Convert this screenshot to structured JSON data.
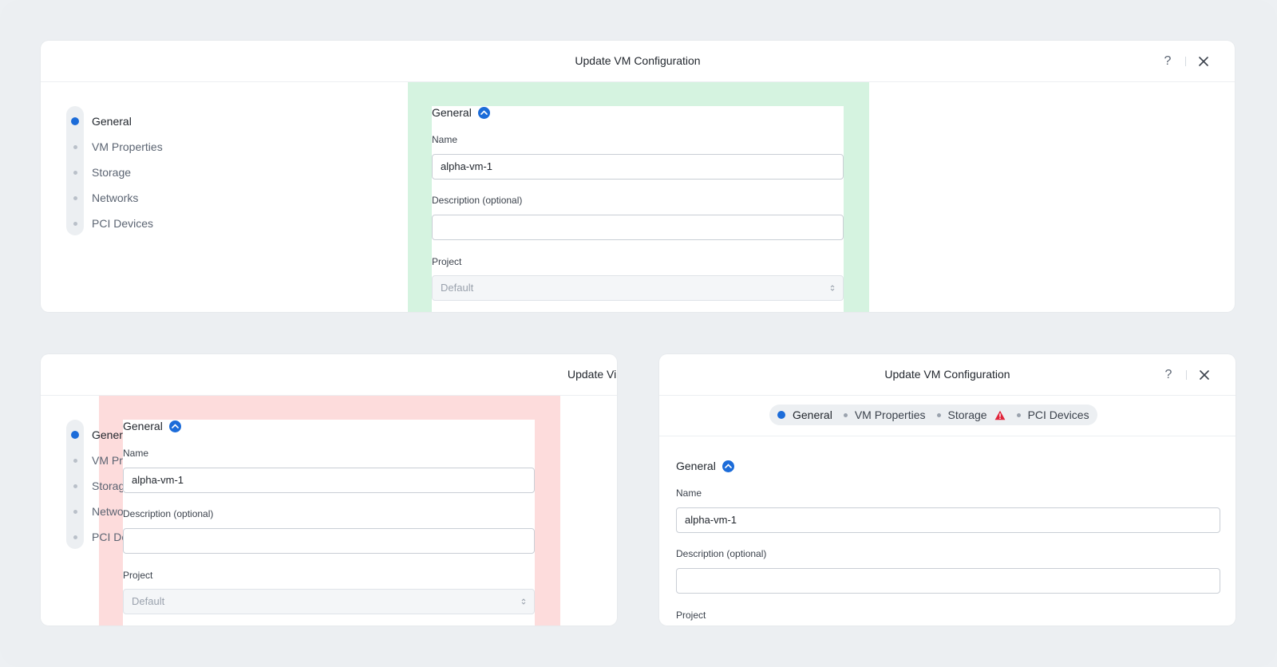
{
  "modal": {
    "title": "Update VM Configuration",
    "help_label": "?",
    "truncated_title": "Update Vi"
  },
  "nav": {
    "items": [
      {
        "label": "General",
        "active": true
      },
      {
        "label": "VM Properties",
        "active": false
      },
      {
        "label": "Storage",
        "active": false
      },
      {
        "label": "Networks",
        "active": false
      },
      {
        "label": "PCI Devices",
        "active": false
      }
    ]
  },
  "tabs": {
    "items": [
      {
        "label": "General",
        "active": true
      },
      {
        "label": "VM Properties",
        "active": false
      },
      {
        "label": "Storage",
        "active": false,
        "warning": true
      },
      {
        "label": "PCI Devices",
        "active": false
      }
    ]
  },
  "form": {
    "section_title": "General",
    "name_label": "Name",
    "name_value": "alpha-vm-1",
    "description_label": "Description (optional)",
    "description_value": "",
    "project_label": "Project",
    "project_value": "Default"
  },
  "colors": {
    "accent": "#1c6cd9",
    "ok_zone": "#d5f3e0",
    "error_zone": "#fddcdc",
    "warning": "#e0243b"
  }
}
